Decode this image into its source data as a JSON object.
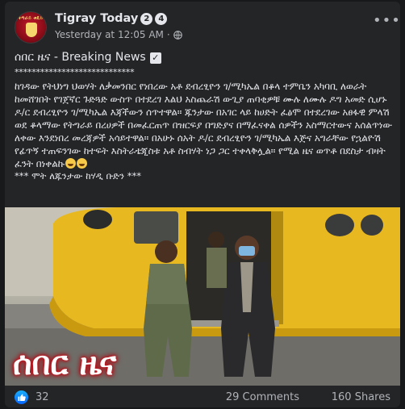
{
  "page": {
    "name": "Tigray Today",
    "badges": [
      "2",
      "4"
    ],
    "avatar_text": "ትግራይ ቱዴይ"
  },
  "post": {
    "timestamp": "Yesterday at 12:05 AM",
    "separator": "·",
    "privacy_icon": "globe-icon",
    "more_icon": "more-options-icon",
    "title": "ሰበር ዜና - Breaking News",
    "title_icon": "check-box-icon",
    "stars": "****************************",
    "body": "ከገዳው የትህነግ ህወሃት ለቃመንበር የነበረው አቶ ደብረፂዮን ገ/ሚካኤል በቆላ ተምቤን አካባቢ ለወራት ከመሸገበት የገጀኛር ጉድጓድ ውስጥ በተደረገ እልህ አስጨራሽ ውጊያ ጠባቂዎቹ ሙሉ ለሙሉ ዶግ አመድ ሲሆኑ ዶ/ር ደብረፂዮን ገ/ሚካኤል እጃችውን ሰጥተዋል። ጁንታው በአገር ላይ ከሀድት ፈፅሞ በተደረገው አፀፋዊ ምላሽ ወደ ቆላማው የትግራይ በረሀዎች በመፈርጠጥ በዝርፍያ በግድያና በማፈናቀል ሰዎችን አስማርተውና አሰልጥነው ለቀው እንደነበረ መረጃዎች አሳይተዋል። በአሁኑ ሰአት ዶ/ር ደብረፂዮን ገ/ሚካኤል እጅና አግራቸው የኋልዮሽ የፊጥኝ ተጠፍንገው ከተፍት እስትራቴጂስቱ አቶ ስብሃት ነጋ ጋር ተቀላቅሏል። የሚል ዜና ወጥቶ በደስታ ብዛት ፈንት በነቀልኩ",
    "footer": "*** ሞት ለጁንታው ከሃዲ ቡድን ***",
    "image_caption": "ሰበር ዜና"
  },
  "reactions": {
    "like_icon": "like-reaction-icon",
    "count": "32",
    "comments": "29 Comments",
    "shares": "160 Shares"
  }
}
